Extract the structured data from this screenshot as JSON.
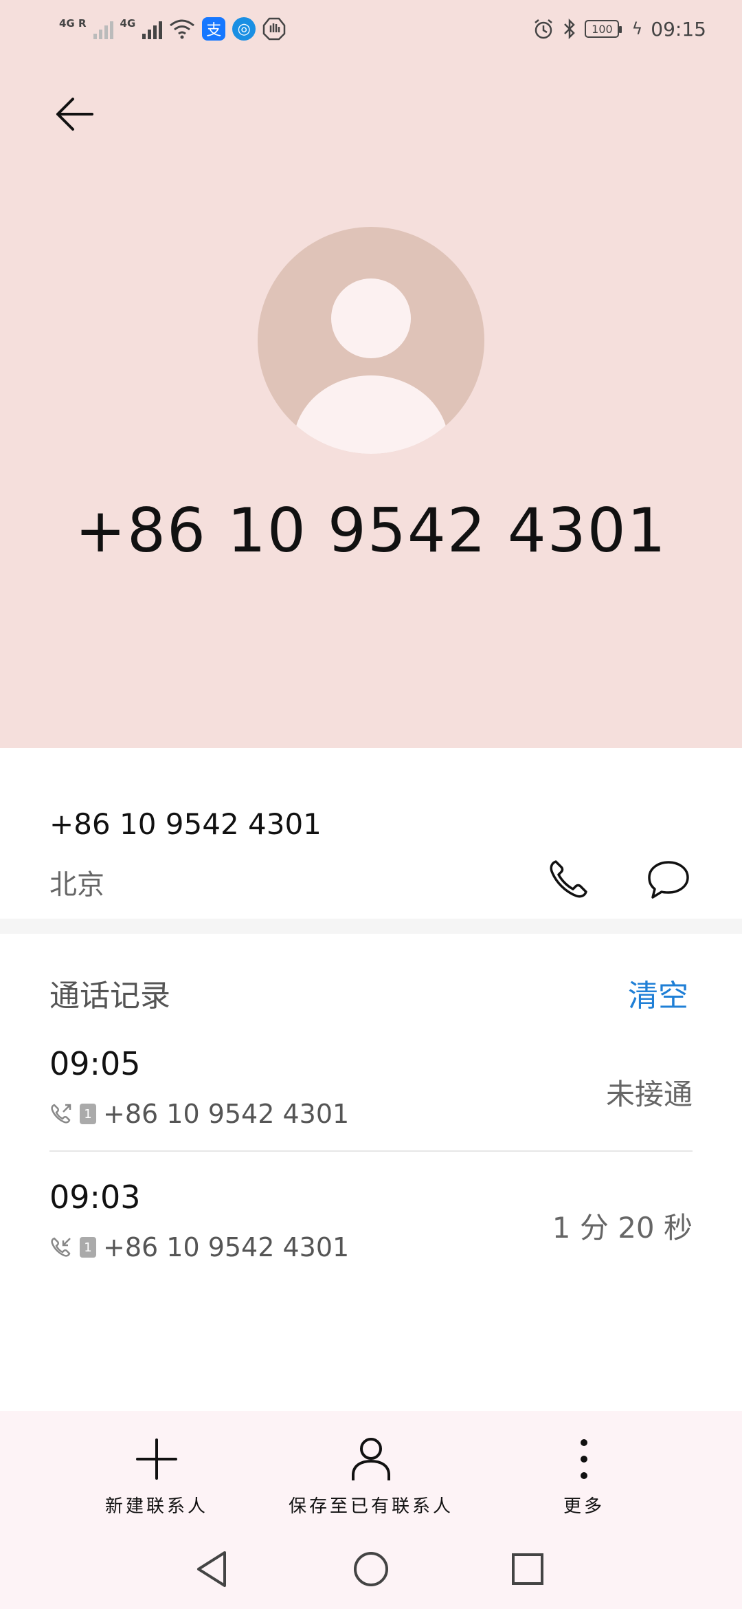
{
  "status_bar": {
    "net1": "4G R",
    "net2": "4G",
    "battery": "100",
    "time": "09:15"
  },
  "contact": {
    "number": "+86 10 9542 4301",
    "location": "北京"
  },
  "call_log": {
    "title": "通话记录",
    "clear_label": "清空",
    "items": [
      {
        "time": "09:05",
        "sim": "1",
        "number": "+86 10 9542 4301",
        "status": "未接通",
        "direction": "outgoing"
      },
      {
        "time": "09:03",
        "sim": "1",
        "number": "+86 10 9542 4301",
        "status": "1 分 20 秒",
        "direction": "incoming"
      }
    ]
  },
  "actions": {
    "new_contact": "新建联系人",
    "save_existing": "保存至已有联系人",
    "more": "更多"
  }
}
